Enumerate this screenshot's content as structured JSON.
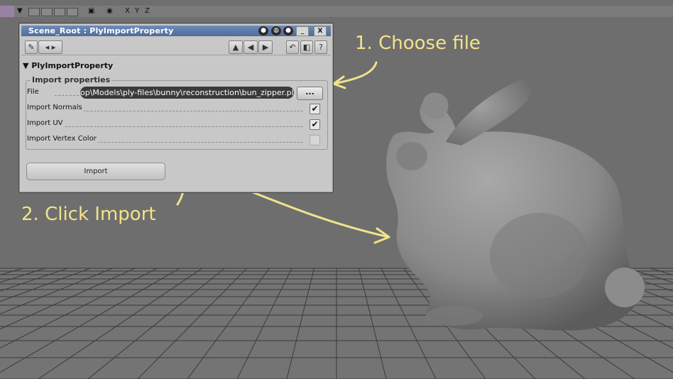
{
  "toolbar": {
    "axes": [
      "X",
      "Y",
      "Z"
    ]
  },
  "dialog": {
    "title": "Scene_Root : PlyImportProperty",
    "title_buttons": [
      "_",
      "X"
    ],
    "tools": {
      "help": "?"
    },
    "section": "PlyImportProperty",
    "group": "Import properties",
    "fields": {
      "file_label": "File",
      "file_value": "op\\Models\\ply-files\\bunny\\reconstruction\\bun_zipper.ply",
      "browse": "...",
      "normals_label": "Import Normals",
      "normals_checked": true,
      "uv_label": "Import UV",
      "uv_checked": true,
      "vcolor_label": "Import Vertex Color",
      "vcolor_checked": false
    },
    "import_button": "Import"
  },
  "annotations": {
    "step1": "1. Choose file",
    "step2": "2. Click Import"
  },
  "colors": {
    "annotation": "#f2e38a",
    "viewport_bg": "#6e6e6e",
    "grid": "#3c3c3c",
    "titlebar": "#4e6c9a"
  }
}
